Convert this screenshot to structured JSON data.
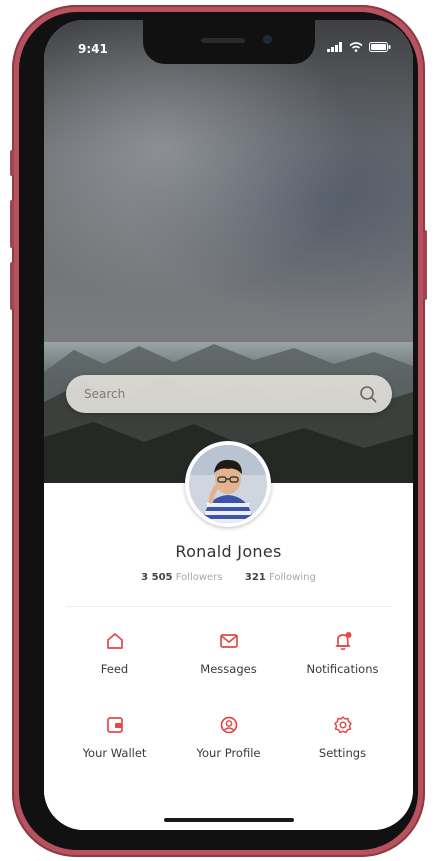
{
  "status_bar": {
    "time": "9:41"
  },
  "search": {
    "placeholder": "Search"
  },
  "profile": {
    "name": "Ronald Jones",
    "followers_count": "3 505",
    "followers_label": "Followers",
    "following_count": "321",
    "following_label": "Following"
  },
  "menu": {
    "items": [
      {
        "label": "Feed",
        "icon": "home-icon"
      },
      {
        "label": "Messages",
        "icon": "mail-icon"
      },
      {
        "label": "Notifications",
        "icon": "bell-icon"
      },
      {
        "label": "Your Wallet",
        "icon": "wallet-icon"
      },
      {
        "label": "Your Profile",
        "icon": "user-icon"
      },
      {
        "label": "Settings",
        "icon": "gear-icon"
      }
    ]
  },
  "colors": {
    "accent": "#e04a4a",
    "frame": "#b8525e",
    "text": "#333333",
    "muted": "#a8a8a8"
  }
}
